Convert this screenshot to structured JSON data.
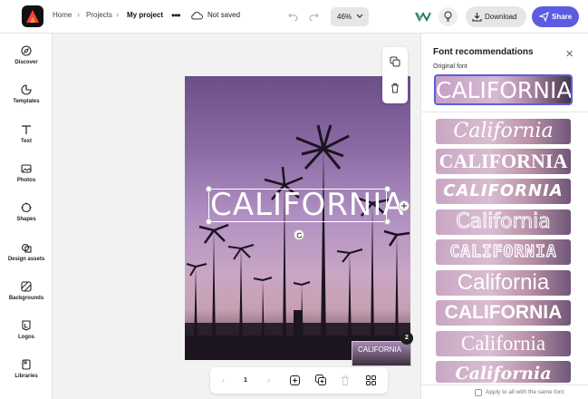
{
  "topbar": {
    "crumbs": [
      "Home",
      "Projects",
      "My project"
    ],
    "status": "Not saved",
    "zoom": "46%",
    "download_label": "Download",
    "share_label": "Share"
  },
  "rail": [
    {
      "label": "Discover",
      "icon": "compass-icon"
    },
    {
      "label": "Templates",
      "icon": "templates-icon"
    },
    {
      "label": "Text",
      "icon": "text-icon"
    },
    {
      "label": "Photos",
      "icon": "photos-icon"
    },
    {
      "label": "Shapes",
      "icon": "shapes-icon"
    },
    {
      "label": "Design assets",
      "icon": "design-assets-icon"
    },
    {
      "label": "Backgrounds",
      "icon": "backgrounds-icon"
    },
    {
      "label": "Logos",
      "icon": "logos-icon"
    },
    {
      "label": "Libraries",
      "icon": "libraries-icon"
    }
  ],
  "canvas": {
    "headline": "CALIFORNIA",
    "page_number": "1",
    "page_count_badge": "2",
    "thumb_text": "CALIFORNIA"
  },
  "panel": {
    "title": "Font recommendations",
    "original_label": "Original font",
    "original_sample": "CALIFORNIA",
    "samples": [
      "California",
      "CALIFORNIA",
      "CALIFORNIA",
      "California",
      "CALIFORNIA",
      "California",
      "CALIFORNIA",
      "California",
      "California"
    ],
    "apply_all_label": "Apply to all with the same font"
  },
  "colors": {
    "accent": "#5c5ce0",
    "sky_top": "#6b4f88",
    "sky_mid": "#b191c2"
  }
}
